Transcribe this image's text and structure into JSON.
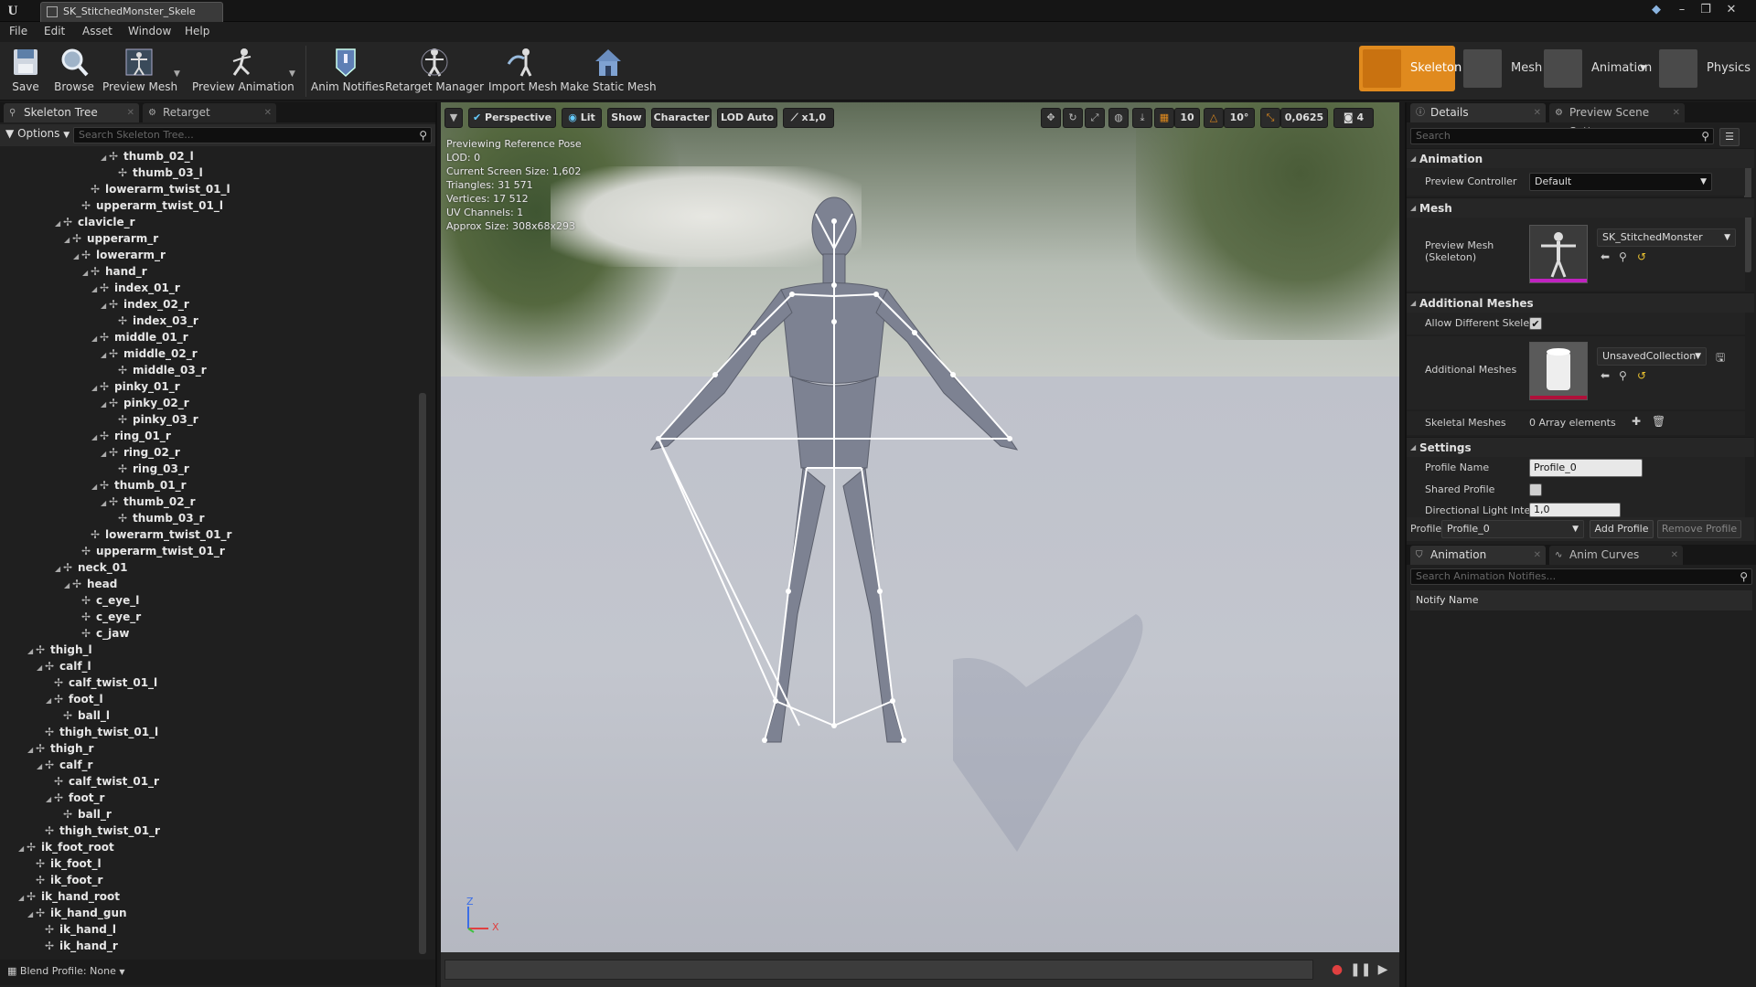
{
  "titlebar": {
    "doc_tab": "SK_StitchedMonster_Skele",
    "logo": "U",
    "min": "–",
    "max": "❐",
    "close": "✕"
  },
  "menu": [
    "File",
    "Edit",
    "Asset",
    "Window",
    "Help"
  ],
  "toolbar": {
    "save": "Save",
    "browse": "Browse",
    "preview_mesh": "Preview Mesh",
    "preview_animation": "Preview Animation",
    "anim_notifies": "Anim Notifies",
    "retarget_manager": "Retarget Manager",
    "import_mesh": "Import Mesh",
    "make_static_mesh": "Make Static Mesh"
  },
  "modes": {
    "skeleton": "Skeleton",
    "mesh": "Mesh",
    "animation": "Animation",
    "physics": "Physics"
  },
  "left_panel": {
    "tab_skeleton_tree": "Skeleton Tree",
    "tab_retarget_manager": "Retarget Manager",
    "options": "Options",
    "search_placeholder": "Search Skeleton Tree...",
    "blend_profile": "Blend Profile: None"
  },
  "tree": [
    {
      "label": "thumb_02_l",
      "indent": 11,
      "arrow": true
    },
    {
      "label": "thumb_03_l",
      "indent": 12,
      "arrow": false
    },
    {
      "label": "lowerarm_twist_01_l",
      "indent": 9,
      "arrow": false
    },
    {
      "label": "upperarm_twist_01_l",
      "indent": 8,
      "arrow": false
    },
    {
      "label": "clavicle_r",
      "indent": 6,
      "arrow": true
    },
    {
      "label": "upperarm_r",
      "indent": 7,
      "arrow": true
    },
    {
      "label": "lowerarm_r",
      "indent": 8,
      "arrow": true
    },
    {
      "label": "hand_r",
      "indent": 9,
      "arrow": true
    },
    {
      "label": "index_01_r",
      "indent": 10,
      "arrow": true
    },
    {
      "label": "index_02_r",
      "indent": 11,
      "arrow": true
    },
    {
      "label": "index_03_r",
      "indent": 12,
      "arrow": false
    },
    {
      "label": "middle_01_r",
      "indent": 10,
      "arrow": true
    },
    {
      "label": "middle_02_r",
      "indent": 11,
      "arrow": true
    },
    {
      "label": "middle_03_r",
      "indent": 12,
      "arrow": false
    },
    {
      "label": "pinky_01_r",
      "indent": 10,
      "arrow": true
    },
    {
      "label": "pinky_02_r",
      "indent": 11,
      "arrow": true
    },
    {
      "label": "pinky_03_r",
      "indent": 12,
      "arrow": false
    },
    {
      "label": "ring_01_r",
      "indent": 10,
      "arrow": true
    },
    {
      "label": "ring_02_r",
      "indent": 11,
      "arrow": true
    },
    {
      "label": "ring_03_r",
      "indent": 12,
      "arrow": false
    },
    {
      "label": "thumb_01_r",
      "indent": 10,
      "arrow": true
    },
    {
      "label": "thumb_02_r",
      "indent": 11,
      "arrow": true
    },
    {
      "label": "thumb_03_r",
      "indent": 12,
      "arrow": false
    },
    {
      "label": "lowerarm_twist_01_r",
      "indent": 9,
      "arrow": false
    },
    {
      "label": "upperarm_twist_01_r",
      "indent": 8,
      "arrow": false
    },
    {
      "label": "neck_01",
      "indent": 6,
      "arrow": true
    },
    {
      "label": "head",
      "indent": 7,
      "arrow": true
    },
    {
      "label": "c_eye_l",
      "indent": 8,
      "arrow": false
    },
    {
      "label": "c_eye_r",
      "indent": 8,
      "arrow": false
    },
    {
      "label": "c_jaw",
      "indent": 8,
      "arrow": false
    },
    {
      "label": "thigh_l",
      "indent": 3,
      "arrow": true
    },
    {
      "label": "calf_l",
      "indent": 4,
      "arrow": true
    },
    {
      "label": "calf_twist_01_l",
      "indent": 5,
      "arrow": false
    },
    {
      "label": "foot_l",
      "indent": 5,
      "arrow": true
    },
    {
      "label": "ball_l",
      "indent": 6,
      "arrow": false
    },
    {
      "label": "thigh_twist_01_l",
      "indent": 4,
      "arrow": false
    },
    {
      "label": "thigh_r",
      "indent": 3,
      "arrow": true
    },
    {
      "label": "calf_r",
      "indent": 4,
      "arrow": true
    },
    {
      "label": "calf_twist_01_r",
      "indent": 5,
      "arrow": false
    },
    {
      "label": "foot_r",
      "indent": 5,
      "arrow": true
    },
    {
      "label": "ball_r",
      "indent": 6,
      "arrow": false
    },
    {
      "label": "thigh_twist_01_r",
      "indent": 4,
      "arrow": false
    },
    {
      "label": "ik_foot_root",
      "indent": 2,
      "arrow": true
    },
    {
      "label": "ik_foot_l",
      "indent": 3,
      "arrow": false
    },
    {
      "label": "ik_foot_r",
      "indent": 3,
      "arrow": false
    },
    {
      "label": "ik_hand_root",
      "indent": 2,
      "arrow": true
    },
    {
      "label": "ik_hand_gun",
      "indent": 3,
      "arrow": true
    },
    {
      "label": "ik_hand_l",
      "indent": 4,
      "arrow": false
    },
    {
      "label": "ik_hand_r",
      "indent": 4,
      "arrow": false
    }
  ],
  "viewport": {
    "perspective": "Perspective",
    "lit": "Lit",
    "show": "Show",
    "character": "Character",
    "lod": "LOD Auto",
    "speed": "x1,0",
    "grid_snap": "10",
    "rot_snap": "10°",
    "scale_snap": "0,0625",
    "cam_speed": "4",
    "info": [
      "Previewing Reference Pose",
      "LOD: 0",
      "Current Screen Size: 1,602",
      "Triangles: 31 571",
      "Vertices: 17 512",
      "UV Channels: 1",
      "Approx Size: 308x68x293"
    ],
    "axis_z": "Z",
    "axis_x": "X"
  },
  "details": {
    "tab_details": "Details",
    "tab_scene": "Preview Scene Sett",
    "search_placeholder": "Search",
    "sec_animation": "Animation",
    "preview_controller_label": "Preview Controller",
    "preview_controller_value": "Default",
    "sec_mesh": "Mesh",
    "preview_mesh_label": "Preview Mesh (Skeleton)",
    "preview_mesh_value": "SK_StitchedMonster",
    "sec_additional": "Additional Meshes",
    "allow_diff_label": "Allow Different Skelet",
    "additional_meshes_label": "Additional Meshes",
    "additional_meshes_value": "UnsavedCollection",
    "skeletal_meshes_label": "Skeletal Meshes",
    "skeletal_meshes_value": "0 Array elements",
    "sec_settings": "Settings",
    "profile_name_label": "Profile Name",
    "profile_name_value": "Profile_0",
    "shared_profile_label": "Shared Profile",
    "dir_light_label": "Directional Light Inten",
    "dir_light_value": "1,0",
    "profile_label": "Profile",
    "profile_value": "Profile_0",
    "add_profile": "Add Profile",
    "remove_profile": "Remove Profile"
  },
  "notifies": {
    "tab_notifies": "Animation Notifies",
    "tab_curves": "Anim Curves",
    "search_placeholder": "Search Animation Notifies...",
    "column": "Notify Name"
  },
  "colors": {
    "accent": "#e08a1e",
    "mesh_strip": "#c022c0"
  }
}
